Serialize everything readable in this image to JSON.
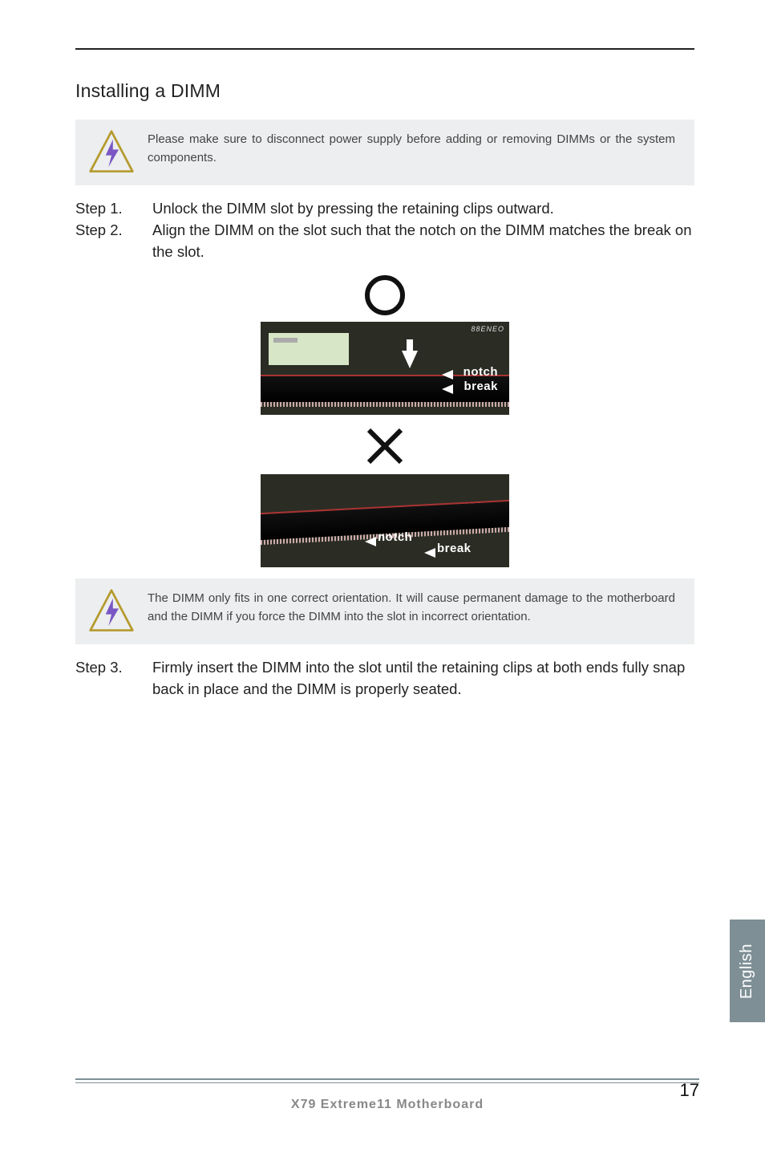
{
  "section_heading": "Installing a DIMM",
  "callouts": {
    "warn1": "Please make sure to disconnect power supply before adding or removing DIMMs or the system components.",
    "warn2": "The DIMM only fits in one correct orientation. It will cause permanent damage to the motherboard and the DIMM if you force the DIMM into the slot in incorrect orientation."
  },
  "steps": {
    "s1_label": "Step 1.",
    "s1_body": "Unlock the DIMM slot by pressing the retaining clips outward.",
    "s2_label": "Step 2.",
    "s2_body": "Align the DIMM on the slot such that the notch on the DIMM matches the break on the slot.",
    "s3_label": "Step 3.",
    "s3_body": "Firmly insert the DIMM into the slot until the retaining clips at both ends fully snap back in place and the DIMM is properly seated."
  },
  "figure_labels": {
    "notch": "notch",
    "break": "break"
  },
  "side_tab": "English",
  "footer": {
    "title": "X79  Extreme11  Motherboard",
    "page": "17"
  }
}
